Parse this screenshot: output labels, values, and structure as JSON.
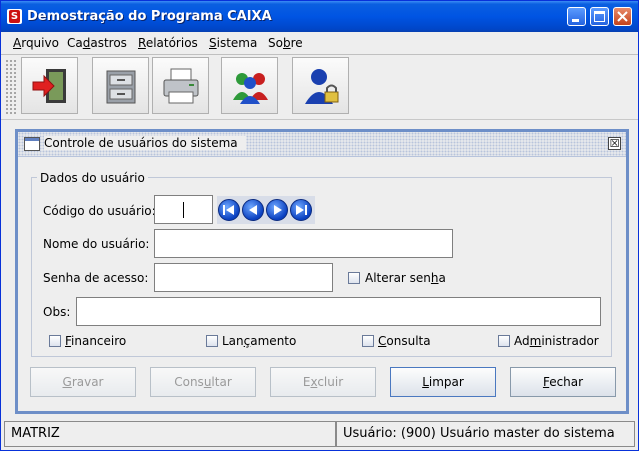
{
  "window": {
    "title": "Demostração do Programa CAIXA",
    "app_icon": "S"
  },
  "menu": [
    {
      "pre": "",
      "u": "A",
      "post": "rquivo"
    },
    {
      "pre": "Ca",
      "u": "d",
      "post": "astros"
    },
    {
      "pre": "",
      "u": "R",
      "post": "elatórios"
    },
    {
      "pre": "",
      "u": "S",
      "post": "istema"
    },
    {
      "pre": "So",
      "u": "b",
      "post": "re"
    }
  ],
  "toolbar": {
    "buttons": [
      "exit-door-icon",
      "filing-cabinet-icon",
      "printer-icon",
      "users-group-icon",
      "user-lock-icon"
    ]
  },
  "form": {
    "title": "Controle de usuários do sistema",
    "close_glyph": "☒",
    "group_title": "Dados do usuário",
    "code_label": "Código do usuário:",
    "code_value": "",
    "name_label": "Nome do usuário:",
    "name_value": "",
    "password_label": "Senha de acesso:",
    "password_value": "",
    "change_password": {
      "pre": "Alterar sen",
      "u": "h",
      "post": "a"
    },
    "obs_label": "Obs:",
    "obs_value": "",
    "permissions": [
      {
        "pre": "",
        "u": "F",
        "post": "inanceiro"
      },
      {
        "pre": "Lan",
        "u": "ç",
        "post": "amento"
      },
      {
        "pre": "",
        "u": "C",
        "post": "onsulta"
      },
      {
        "pre": "Ad",
        "u": "m",
        "post": "inistrador"
      }
    ],
    "buttons": [
      {
        "pre": "",
        "u": "G",
        "post": "ravar",
        "disabled": true
      },
      {
        "pre": "Cons",
        "u": "u",
        "post": "ltar",
        "disabled": true
      },
      {
        "pre": "E",
        "u": "x",
        "post": "cluir",
        "disabled": true
      },
      {
        "pre": "",
        "u": "L",
        "post": "impar",
        "disabled": false
      },
      {
        "pre": "",
        "u": "F",
        "post": "echar",
        "disabled": false
      }
    ]
  },
  "status": {
    "branch": "MATRIZ",
    "user": "Usuário: (900) Usuário master do sistema"
  },
  "colors": {
    "title_bar": "#0054e3",
    "frame_border": "#6e8fc8",
    "nav_button": "#1a5ad8"
  }
}
